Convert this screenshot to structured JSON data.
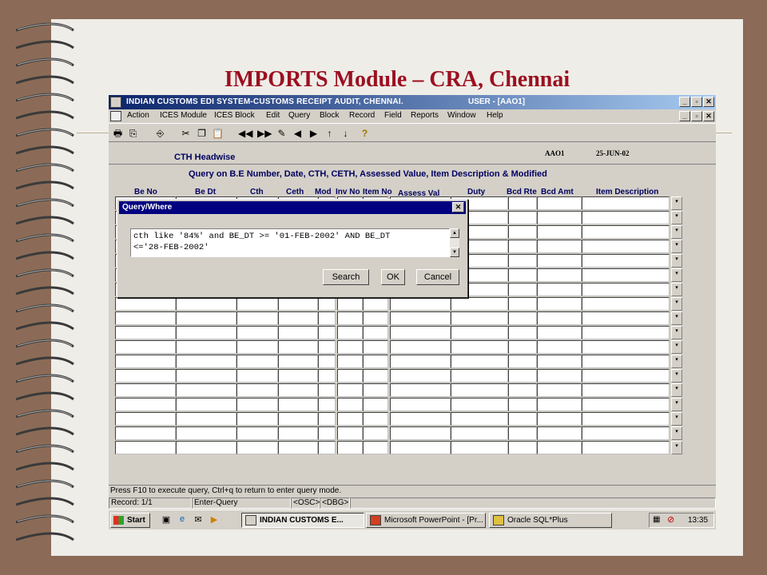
{
  "slide": {
    "title": "IMPORTS Module – CRA, Chennai"
  },
  "window": {
    "title": "INDIAN CUSTOMS EDI SYSTEM-CUSTOMS RECEIPT AUDIT, CHENNAI.",
    "user": "USER - [AAO1]"
  },
  "menu": [
    "Action",
    "ICES Module",
    "ICES Block",
    "Edit",
    "Query",
    "Block",
    "Record",
    "Field",
    "Reports",
    "Window",
    "Help"
  ],
  "form": {
    "heading": "CTH Headwise",
    "user_code": "AAO1",
    "date": "25-JUN-02",
    "subtitle": "Query on B.E Number, Date, CTH, CETH, Assessed Value, Item Description & Modified"
  },
  "table": {
    "columns": [
      "Be No",
      "Be Dt",
      "Cth",
      "Ceth",
      "Mod",
      "Inv No",
      "Item No",
      "Assess Val",
      "Duty",
      "Bcd Rte",
      "Bcd Amt",
      "Item Description"
    ],
    "row_count": 18
  },
  "status": {
    "hint": "Press F10  to execute query, Ctrl+q  to return to enter query mode.",
    "record": "Record: 1/1",
    "mode": "Enter-Query",
    "osc": "<OSC>",
    "dbg": "<DBG>"
  },
  "dialog": {
    "title": "Query/Where",
    "query_text": "cth like '84%' and BE_DT >= '01-FEB-2002' AND BE_DT\n<='28-FEB-2002'",
    "buttons": {
      "search": "Search",
      "ok": "OK",
      "cancel": "Cancel"
    }
  },
  "taskbar": {
    "start": "Start",
    "tasks": [
      "INDIAN CUSTOMS E...",
      "Microsoft PowerPoint - [Pr...",
      "Oracle SQL*Plus"
    ],
    "clock": "13:35"
  },
  "colors": {
    "title": "#9b1020",
    "titlebar": "#0a246a",
    "dialog_title": "#000080"
  }
}
